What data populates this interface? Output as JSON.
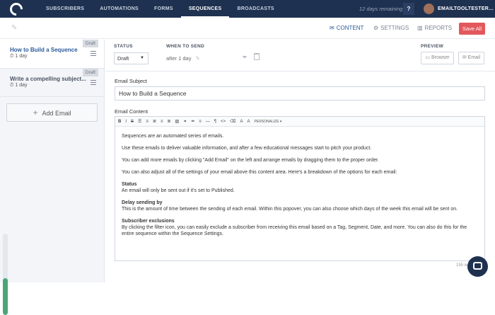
{
  "nav": {
    "links": [
      "SUBSCRIBERS",
      "AUTOMATIONS",
      "FORMS",
      "SEQUENCES",
      "BROADCASTS"
    ],
    "active": "SEQUENCES",
    "trial_text": "12 days remaining",
    "help_label": "?",
    "username": "EMAILTOOLTESTER..."
  },
  "toolbar": {
    "content_label": "CONTENT",
    "settings_label": "SETTINGS",
    "reports_label": "REPORTS",
    "save_label": "Save All"
  },
  "sidebar": {
    "items": [
      {
        "title": "How to Build a Sequence",
        "delay": "1 day",
        "badge": "Draft"
      },
      {
        "title": "Write a compelling subject...",
        "delay": "1 day",
        "badge": "Draft"
      }
    ],
    "add_label": "Add Email",
    "progress": 0.45
  },
  "settings": {
    "status_label": "STATUS",
    "status_value": "Draft",
    "when_label": "WHEN TO SEND",
    "when_value": "after 1 day",
    "preview_label": "PREVIEW",
    "browser_label": "Browser",
    "email_label": "Email"
  },
  "form": {
    "subject_label": "Email Subject",
    "subject_value": "How to Build a Sequence",
    "content_label": "Email Content",
    "personalize_label": "PERSONALIZE ▾",
    "char_count": "155 w",
    "body": {
      "p1": "Sequences are an automated series of emails.",
      "p2": "Use these emails to deliver valuable information, and after a few educational messages start to pitch your product.",
      "p3": "You can add more emails by clicking \"Add Email\" on the left and arrange emails by dragging them to the proper order.",
      "p4": "You can also adjust all of the settings of your email above this content area. Here's a breakdown of the options for each email:",
      "h1": "Status",
      "t1": "An email will only be sent out if it's set to Published.",
      "h2": "Delay sending by",
      "t2": "This is the amount of time between the sending of each email. Within this popover, you can also choose which days of the week this email will be sent on.",
      "h3": "Subscriber exclusions",
      "t3": "By clicking the filter icon, you can easily exclude a subscriber from receiving this email based on a Tag, Segment, Date, and more. You can also do this for the entire sequence within the Sequence Settings."
    }
  }
}
